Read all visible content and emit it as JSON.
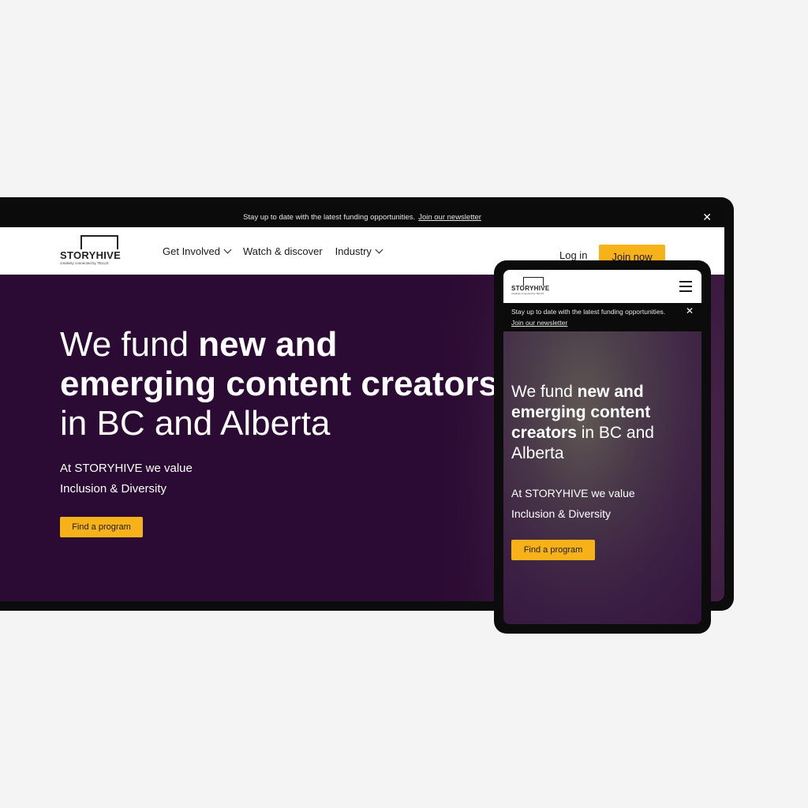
{
  "colors": {
    "background": "#f4f4f4",
    "frame": "#0c0c0c",
    "hero_purple": "#2b0a33",
    "accent_yellow": "#f7b219",
    "banner_black": "#0b0b0b"
  },
  "brand": {
    "name": "STORYHIVE",
    "tagline": "creativity connected by TELUS"
  },
  "desktop": {
    "banner": {
      "text": "Stay up to date with the latest funding opportunities.",
      "link": "Join our newsletter",
      "close_icon": "close-icon"
    },
    "nav": {
      "items": [
        {
          "label": "Get Involved",
          "has_dropdown": true
        },
        {
          "label": "Watch & discover",
          "has_dropdown": false
        },
        {
          "label": "Industry",
          "has_dropdown": true
        }
      ],
      "login": "Log in",
      "join": "Join now"
    },
    "hero": {
      "headline_regular_1": "We fund ",
      "headline_bold": "new and emerging content creators",
      "headline_regular_2": " in BC and Alberta",
      "sub_line_1": "At STORYHIVE we value",
      "sub_line_2": "Inclusion & Diversity",
      "cta": "Find a program"
    }
  },
  "mobile": {
    "nav": {
      "menu_icon": "hamburger-menu-icon"
    },
    "banner": {
      "text": "Stay up to date with the latest funding opportunities.",
      "link": "Join our newsletter",
      "close_icon": "close-icon"
    },
    "hero": {
      "headline_regular_1": "We fund ",
      "headline_bold": "new and emerging content creators",
      "headline_regular_2": " in BC and Alberta",
      "sub_line_1": "At STORYHIVE we value",
      "sub_line_2": "Inclusion & Diversity",
      "cta": "Find a program"
    }
  }
}
